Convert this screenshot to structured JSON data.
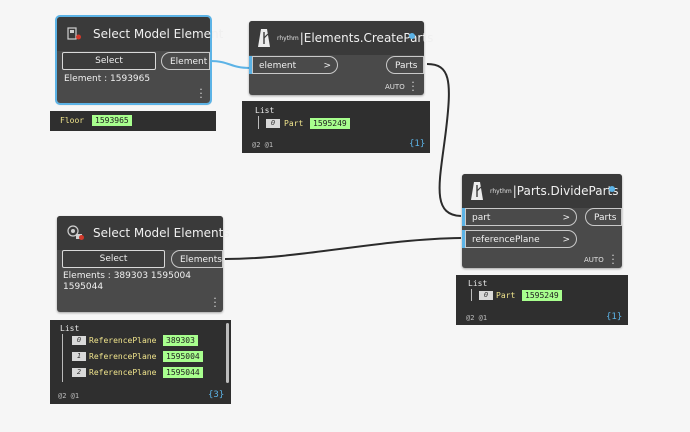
{
  "colors": {
    "accent": "#5cb3e6",
    "value_highlight": "#a8ff8e",
    "node_body": "#4a4a4a",
    "preview_bg": "#2f2f2f"
  },
  "node_select_element": {
    "title": "Select Model Element",
    "icon": "select-model-element-icon",
    "select_label": "Select",
    "output_label": "Element",
    "info_text": "Element : 1593965"
  },
  "preview_floor": {
    "type": "Floor",
    "value": "1593965"
  },
  "node_create_parts": {
    "prefix": "rhythm",
    "title": "|Elements.CreateParts",
    "icon": "rhythm-icon",
    "input_label": "element",
    "input_chevron": ">",
    "output_label": "Parts",
    "lacing": "AUTO"
  },
  "preview_create_parts": {
    "list_label": "List",
    "index": "0",
    "type": "Part",
    "value": "1595249",
    "footer": "@2 @1",
    "count": "{1}"
  },
  "node_divide_parts": {
    "prefix": "rhythm",
    "title": "|Parts.DivideParts",
    "icon": "rhythm-icon",
    "input1_label": "part",
    "input2_label": "referencePlane",
    "input_chevron": ">",
    "output_label": "Parts",
    "lacing": "AUTO"
  },
  "preview_divide_parts": {
    "list_label": "List",
    "index": "0",
    "type": "Part",
    "value": "1595249",
    "footer": "@2 @1",
    "count": "{1}"
  },
  "node_select_elements": {
    "title": "Select Model Elements",
    "icon": "select-model-elements-icon",
    "select_label": "Select",
    "output_label": "Elements",
    "info_line1": "Elements : 389303 1595004",
    "info_line2": "1595044"
  },
  "preview_ref_planes": {
    "list_label": "List",
    "items": [
      {
        "index": "0",
        "type": "ReferencePlane",
        "value": "389303"
      },
      {
        "index": "1",
        "type": "ReferencePlane",
        "value": "1595004"
      },
      {
        "index": "2",
        "type": "ReferencePlane",
        "value": "1595044"
      }
    ],
    "footer": "@2 @1",
    "count": "{3}"
  }
}
